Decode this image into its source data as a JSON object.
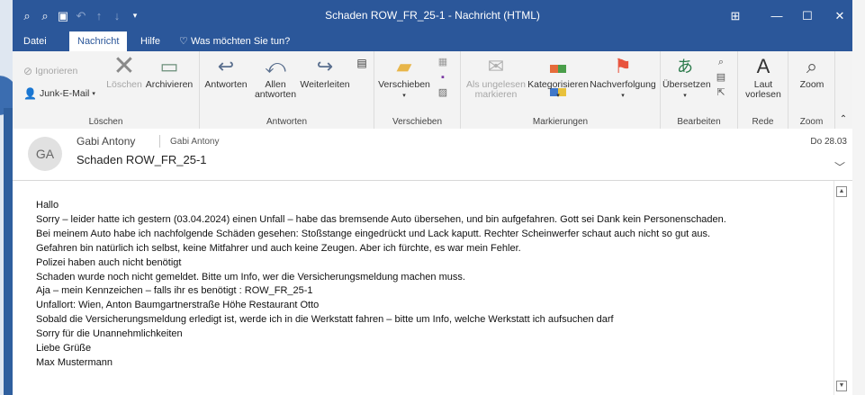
{
  "window": {
    "title": "Schaden ROW_FR_25-1  -  Nachricht (HTML)"
  },
  "colors": {
    "titlebar": "#2b579a",
    "accent_flag": "#e8543e"
  },
  "quick_access": [
    "search-icon",
    "search-icon",
    "save-icon",
    "undo-icon",
    "up-arrow-icon",
    "down-arrow-icon",
    "customize-icon"
  ],
  "tabs": {
    "datei": "Datei",
    "nachricht": "Nachricht",
    "hilfe": "Hilfe",
    "tell_me": "Was möchten Sie tun?"
  },
  "ribbon": {
    "loeschen": {
      "label": "Löschen",
      "ignorieren": "Ignorieren",
      "junk": "Junk-E-Mail",
      "loeschen_btn": "Löschen",
      "archivieren": "Archivieren"
    },
    "antworten": {
      "label": "Antworten",
      "antworten": "Antworten",
      "allen_line1": "Allen",
      "allen_line2": "antworten",
      "weiterleiten": "Weiterleiten"
    },
    "verschieben": {
      "label": "Verschieben",
      "verschieben": "Verschieben"
    },
    "markierungen": {
      "label": "Markierungen",
      "ungelesen_line1": "Als ungelesen",
      "ungelesen_line2": "markieren",
      "kategorisieren": "Kategorisieren",
      "nachverfolgung": "Nachverfolgung"
    },
    "bearbeiten": {
      "label": "Bearbeiten",
      "uebersetzen": "Übersetzen"
    },
    "rede": {
      "label": "Rede",
      "laut_line1": "Laut",
      "laut_line2": "vorlesen"
    },
    "zoom": {
      "label": "Zoom",
      "zoom": "Zoom"
    }
  },
  "message": {
    "avatar_initials": "GA",
    "sender_name": "Gabi Antony",
    "sender_email": "Gabi Antony",
    "subject": "Schaden ROW_FR_25-1",
    "date": "Do 28.03",
    "body_lines": [
      "Hallo",
      "Sorry – leider hatte ich gestern (03.04.2024) einen Unfall – habe das bremsende Auto übersehen, und bin aufgefahren. Gott sei Dank kein Personenschaden.",
      "Bei meinem Auto habe ich nachfolgende Schäden gesehen: Stoßstange eingedrückt und Lack kaputt. Rechter Scheinwerfer schaut auch nicht so gut aus.",
      "Gefahren bin natürlich ich selbst, keine Mitfahrer und auch keine Zeugen. Aber ich fürchte, es war mein Fehler.",
      "Polizei haben auch nicht benötigt",
      "Schaden wurde noch nicht gemeldet. Bitte um Info, wer die Versicherungsmeldung machen muss.",
      "Aja – mein Kennzeichen – falls ihr es benötigt : ROW_FR_25-1",
      "Unfallort: Wien, Anton Baumgartnerstraße Höhe Restaurant Otto",
      "Sobald die Versicherungsmeldung erledigt ist, werde ich in die Werkstatt fahren – bitte um Info, welche Werkstatt ich aufsuchen darf",
      "Sorry für die Unannehmlichkeiten",
      "Liebe Grüße",
      "Max Mustermann"
    ]
  }
}
